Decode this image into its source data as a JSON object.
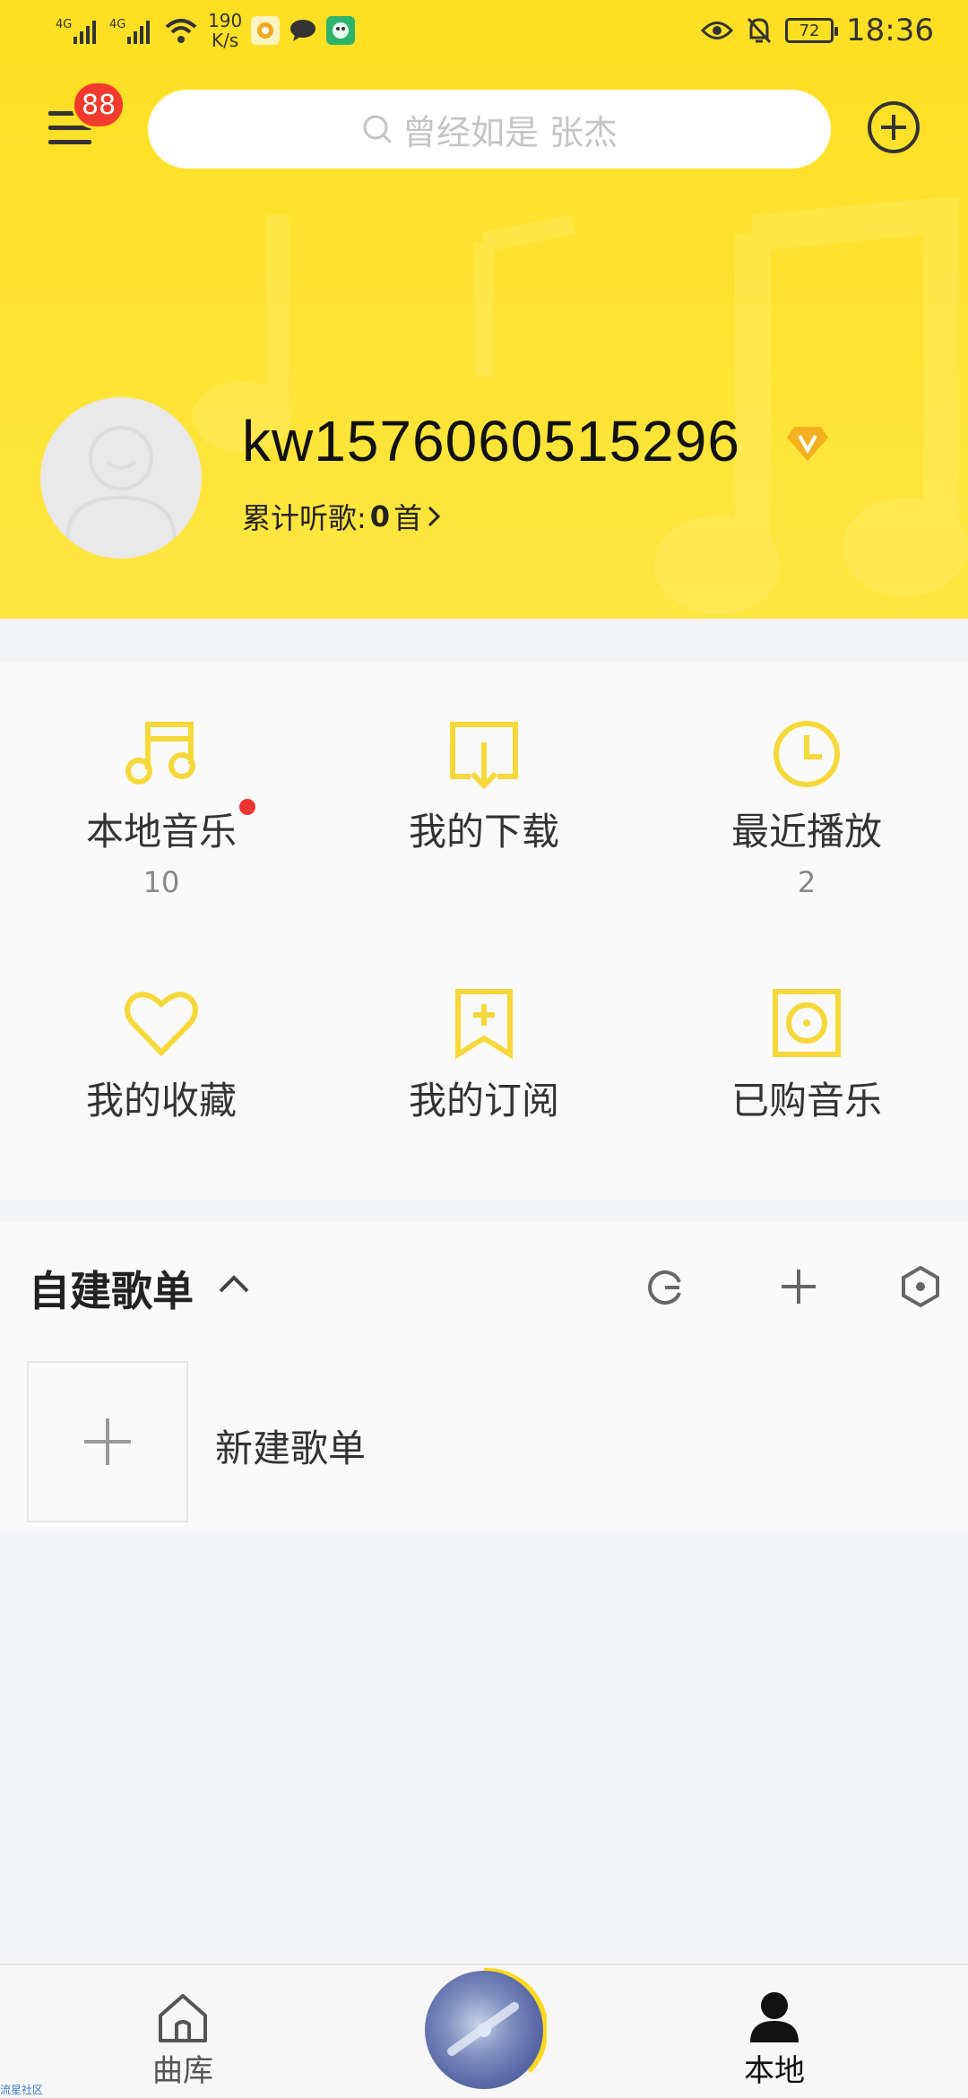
{
  "status_bar": {
    "signal_1": "4G",
    "signal_2": "4G",
    "speed_value": "190",
    "speed_unit": "K/s",
    "battery": "72",
    "time": "18:36"
  },
  "header": {
    "menu_badge": "88",
    "search_placeholder": "曾经如是 张杰"
  },
  "profile": {
    "username": "kw1576060515296",
    "listen_label": "累计听歌: ",
    "listen_count": "0",
    "listen_unit": "首"
  },
  "grid": [
    {
      "label": "本地音乐",
      "count": "10",
      "icon": "music-note-icon",
      "has_dot": true
    },
    {
      "label": "我的下载",
      "count": "",
      "icon": "download-icon"
    },
    {
      "label": "最近播放",
      "count": "2",
      "icon": "clock-icon"
    },
    {
      "label": "我的收藏",
      "count": "",
      "icon": "heart-icon"
    },
    {
      "label": "我的订阅",
      "count": "",
      "icon": "bookmark-plus-icon"
    },
    {
      "label": "已购音乐",
      "count": "",
      "icon": "disc-icon"
    }
  ],
  "playlists": {
    "title": "自建歌单",
    "new_label": "新建歌单"
  },
  "tabbar": {
    "library": "曲库",
    "local": "本地"
  },
  "footer": {
    "corner_text": "流星社区"
  },
  "colors": {
    "accent": "#ffdf22",
    "icon_yellow": "#f7d83a",
    "badge_red": "#f23b2e"
  }
}
